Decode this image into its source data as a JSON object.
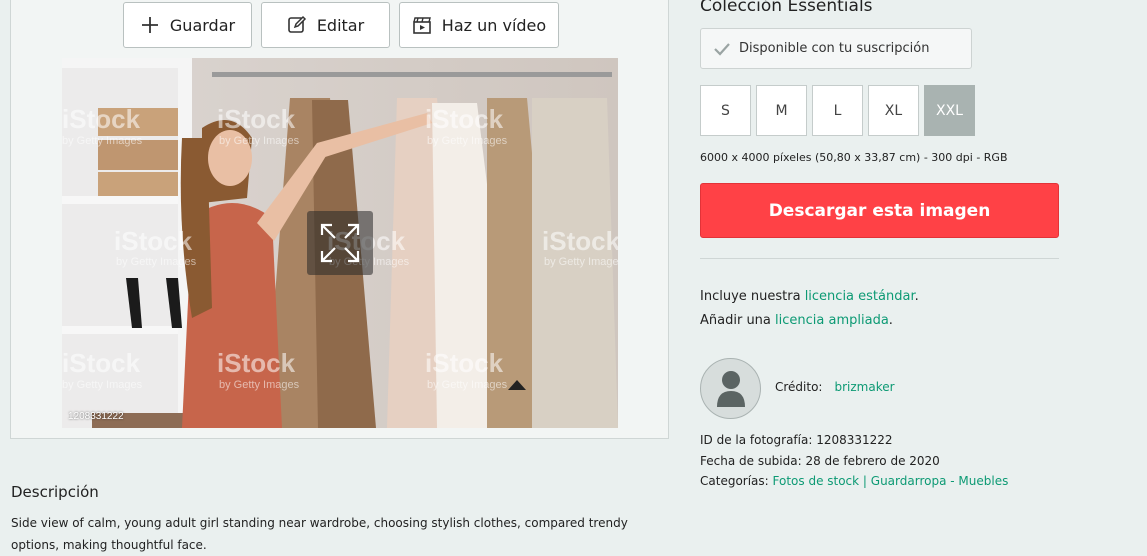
{
  "actions": {
    "save_label": "Guardar",
    "edit_label": "Editar",
    "video_label": "Haz un vídeo"
  },
  "image": {
    "id_overlay": "1208331222",
    "watermark_brand": "iStock",
    "watermark_sub": "by Getty Images"
  },
  "description": {
    "title": "Descripción",
    "text": "Side view of calm, young adult girl standing near wardrobe, choosing stylish clothes, compared trendy options, making thoughtful face."
  },
  "collection": {
    "title": "Colección Essentials",
    "subscription_label": "Disponible con tu suscripción"
  },
  "sizes": [
    "S",
    "M",
    "L",
    "XL",
    "XXL"
  ],
  "selected_size": "XXL",
  "dimensions": "6000 x 4000 píxeles (50,80 x 33,87 cm) - 300 dpi - RGB",
  "download_label": "Descargar esta imagen",
  "license": {
    "line1_prefix": "Incluye nuestra ",
    "line1_link": "licencia estándar",
    "line1_suffix": ".",
    "line2_prefix": "Añadir una ",
    "line2_link": "licencia ampliada",
    "line2_suffix": "."
  },
  "credit": {
    "label": "Crédito:",
    "author": "brizmaker"
  },
  "meta": {
    "photo_id_label": "ID de la fotografía: ",
    "photo_id": "1208331222",
    "upload_label": "Fecha de subida: ",
    "upload_date": "28 de febrero de 2020",
    "categories_label": "Categorías: ",
    "category_1": "Fotos de stock",
    "separator": " | ",
    "category_2": "Guardarropa - Muebles"
  },
  "colors": {
    "accent": "#ff4146",
    "link": "#0d9a74",
    "background": "#eaf0ef"
  }
}
